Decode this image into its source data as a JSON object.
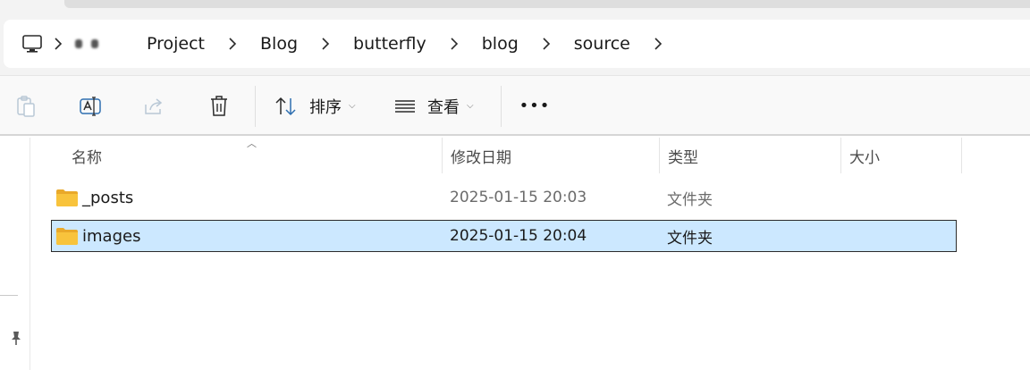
{
  "breadcrumbs": [
    "Project",
    "Blog",
    "butterfly",
    "blog",
    "source"
  ],
  "toolbar": {
    "sort_label": "排序",
    "view_label": "查看",
    "more_label": "•••"
  },
  "columns": {
    "name": "名称",
    "date": "修改日期",
    "type": "类型",
    "size": "大小"
  },
  "files": [
    {
      "name": "_posts",
      "date": "2025-01-15 20:03",
      "type": "文件夹",
      "size": "",
      "selected": false
    },
    {
      "name": "images",
      "date": "2025-01-15 20:04",
      "type": "文件夹",
      "size": "",
      "selected": true
    }
  ],
  "colors": {
    "selection_bg": "#cce8ff",
    "folder_yellow": "#f8c33c"
  }
}
